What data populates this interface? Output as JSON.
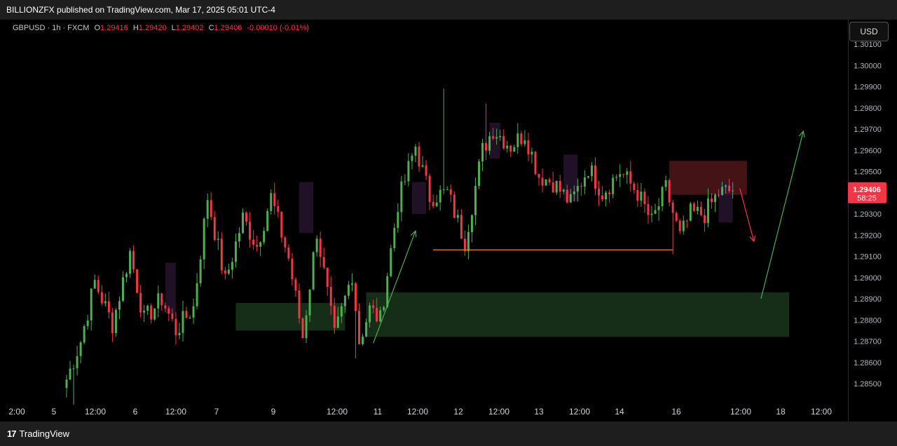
{
  "header": {
    "publisher_line": "BILLIONZFX published on TradingView.com, Mar 17, 2025 05:01 UTC-4"
  },
  "legend": {
    "symbol": "GBPUSD · 1h · FXCM",
    "o_label": "O",
    "o_value": "1.29416",
    "h_label": "H",
    "h_value": "1.29420",
    "l_label": "L",
    "l_value": "1.29402",
    "c_label": "C",
    "c_value": "1.29406",
    "change": "-0.00010 (-0.01%)"
  },
  "currency_button": "USD",
  "last_price": {
    "value": "1.29406",
    "countdown": "58:25"
  },
  "footer": {
    "brand": "TradingView",
    "logo_mark": "17"
  },
  "colors": {
    "up": "#4caf50",
    "down": "#f23645",
    "supply_zone": "#5a1a1e",
    "demand_zone": "#1b3a1e",
    "ob_box": "#2d1838",
    "level_line": "#c77a2a"
  },
  "chart_data": {
    "type": "candlestick",
    "symbol": "GBPUSD",
    "timeframe": "1h",
    "ylim": [
      1.2845,
      1.3012
    ],
    "y_ticks": [
      "1.30100",
      "1.30000",
      "1.29900",
      "1.29800",
      "1.29700",
      "1.29600",
      "1.29500",
      "1.29400",
      "1.29300",
      "1.29200",
      "1.29100",
      "1.29000",
      "1.28900",
      "1.28800",
      "1.28700",
      "1.28600",
      "1.28500"
    ],
    "x_ticks": [
      "2:00",
      "5",
      "12:00",
      "6",
      "12:00",
      "7",
      "9",
      "12:00",
      "11",
      "12:00",
      "12",
      "12:00",
      "13",
      "12:00",
      "14",
      "16",
      "12:00",
      "18",
      "12:00"
    ],
    "waypoints": [
      [
        0,
        1.2852
      ],
      [
        4,
        1.287
      ],
      [
        8,
        1.2898
      ],
      [
        13,
        1.2878
      ],
      [
        18,
        1.2912
      ],
      [
        22,
        1.288
      ],
      [
        27,
        1.289
      ],
      [
        31,
        1.2875
      ],
      [
        36,
        1.2886
      ],
      [
        40,
        1.2938
      ],
      [
        45,
        1.2898
      ],
      [
        50,
        1.2928
      ],
      [
        54,
        1.2915
      ],
      [
        58,
        1.2938
      ],
      [
        63,
        1.2909
      ],
      [
        67,
        1.2872
      ],
      [
        71,
        1.2922
      ],
      [
        76,
        1.2872
      ],
      [
        81,
        1.2902
      ],
      [
        83,
        1.287
      ],
      [
        86,
        1.2885
      ],
      [
        89,
        1.288
      ],
      [
        94,
        1.2935
      ],
      [
        99,
        1.2962
      ],
      [
        103,
        1.2938
      ],
      [
        108,
        1.294
      ],
      [
        113,
        1.2917
      ],
      [
        118,
        1.296
      ],
      [
        121,
        1.297
      ],
      [
        126,
        1.2962
      ],
      [
        130,
        1.2968
      ],
      [
        134,
        1.2948
      ],
      [
        138,
        1.2945
      ],
      [
        143,
        1.2935
      ],
      [
        148,
        1.2952
      ],
      [
        152,
        1.294
      ],
      [
        157,
        1.295
      ],
      [
        162,
        1.294
      ],
      [
        166,
        1.2926
      ],
      [
        170,
        1.2942
      ],
      [
        174,
        1.2919
      ],
      [
        177,
        1.293
      ],
      [
        181,
        1.293
      ],
      [
        185,
        1.294
      ],
      [
        189,
        1.2941
      ]
    ],
    "wicks": [
      {
        "idx": 107,
        "high": 1.2989
      },
      {
        "idx": 119,
        "high": 1.2982
      },
      {
        "idx": 82,
        "low": 1.2862
      },
      {
        "idx": 2,
        "low": 1.284
      },
      {
        "idx": 172,
        "low": 1.2911
      }
    ],
    "annotations": [
      {
        "type": "supply_zone",
        "x0": 171,
        "x1": 193,
        "y0": 1.2955,
        "y1": 1.2939
      },
      {
        "type": "demand_zone",
        "x0": 48,
        "x1": 79,
        "y0": 1.2888,
        "y1": 1.2875
      },
      {
        "type": "demand_zone",
        "x0": 85,
        "x1": 205,
        "y0": 1.2893,
        "y1": 1.2872
      },
      {
        "type": "level_line",
        "x0": 104,
        "x1": 172,
        "y": 1.2913
      },
      {
        "type": "box",
        "x0": 28,
        "x1": 31,
        "y0": 1.2907,
        "y1": 1.2883
      },
      {
        "type": "box",
        "x0": 66,
        "x1": 70,
        "y0": 1.2945,
        "y1": 1.2921
      },
      {
        "type": "box",
        "x0": 98,
        "x1": 102,
        "y0": 1.2945,
        "y1": 1.293
      },
      {
        "type": "box",
        "x0": 120,
        "x1": 123,
        "y0": 1.2973,
        "y1": 1.2956
      },
      {
        "type": "box",
        "x0": 141,
        "x1": 145,
        "y0": 1.2958,
        "y1": 1.2936
      },
      {
        "type": "box",
        "x0": 185,
        "x1": 189,
        "y0": 1.2945,
        "y1": 1.2926
      },
      {
        "type": "arrow_up",
        "x0": 87,
        "y0": 1.2869,
        "x1": 99,
        "y1": 1.2922
      },
      {
        "type": "arrow_down",
        "x0": 191,
        "y0": 1.2942,
        "x1": 195,
        "y1": 1.2917
      },
      {
        "type": "arrow_up",
        "x0": 197,
        "y0": 1.289,
        "x1": 209,
        "y1": 1.2969
      }
    ]
  }
}
